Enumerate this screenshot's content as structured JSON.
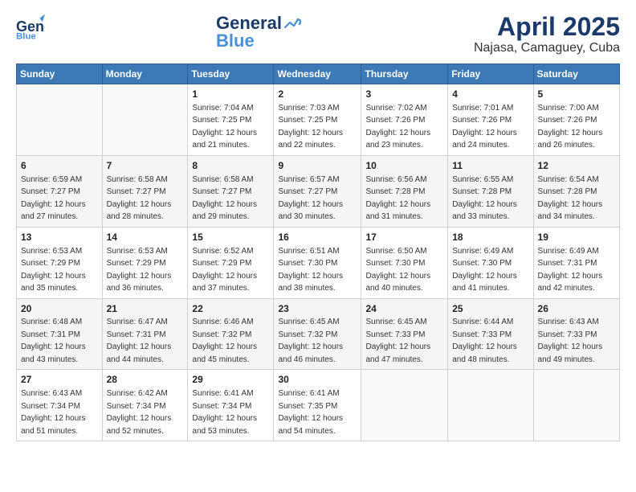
{
  "header": {
    "logo_general": "General",
    "logo_blue": "Blue",
    "month": "April 2025",
    "location": "Najasa, Camaguey, Cuba"
  },
  "days_of_week": [
    "Sunday",
    "Monday",
    "Tuesday",
    "Wednesday",
    "Thursday",
    "Friday",
    "Saturday"
  ],
  "weeks": [
    [
      {
        "day": "",
        "sunrise": "",
        "sunset": "",
        "daylight": ""
      },
      {
        "day": "",
        "sunrise": "",
        "sunset": "",
        "daylight": ""
      },
      {
        "day": "1",
        "sunrise": "Sunrise: 7:04 AM",
        "sunset": "Sunset: 7:25 PM",
        "daylight": "Daylight: 12 hours and 21 minutes."
      },
      {
        "day": "2",
        "sunrise": "Sunrise: 7:03 AM",
        "sunset": "Sunset: 7:25 PM",
        "daylight": "Daylight: 12 hours and 22 minutes."
      },
      {
        "day": "3",
        "sunrise": "Sunrise: 7:02 AM",
        "sunset": "Sunset: 7:26 PM",
        "daylight": "Daylight: 12 hours and 23 minutes."
      },
      {
        "day": "4",
        "sunrise": "Sunrise: 7:01 AM",
        "sunset": "Sunset: 7:26 PM",
        "daylight": "Daylight: 12 hours and 24 minutes."
      },
      {
        "day": "5",
        "sunrise": "Sunrise: 7:00 AM",
        "sunset": "Sunset: 7:26 PM",
        "daylight": "Daylight: 12 hours and 26 minutes."
      }
    ],
    [
      {
        "day": "6",
        "sunrise": "Sunrise: 6:59 AM",
        "sunset": "Sunset: 7:27 PM",
        "daylight": "Daylight: 12 hours and 27 minutes."
      },
      {
        "day": "7",
        "sunrise": "Sunrise: 6:58 AM",
        "sunset": "Sunset: 7:27 PM",
        "daylight": "Daylight: 12 hours and 28 minutes."
      },
      {
        "day": "8",
        "sunrise": "Sunrise: 6:58 AM",
        "sunset": "Sunset: 7:27 PM",
        "daylight": "Daylight: 12 hours and 29 minutes."
      },
      {
        "day": "9",
        "sunrise": "Sunrise: 6:57 AM",
        "sunset": "Sunset: 7:27 PM",
        "daylight": "Daylight: 12 hours and 30 minutes."
      },
      {
        "day": "10",
        "sunrise": "Sunrise: 6:56 AM",
        "sunset": "Sunset: 7:28 PM",
        "daylight": "Daylight: 12 hours and 31 minutes."
      },
      {
        "day": "11",
        "sunrise": "Sunrise: 6:55 AM",
        "sunset": "Sunset: 7:28 PM",
        "daylight": "Daylight: 12 hours and 33 minutes."
      },
      {
        "day": "12",
        "sunrise": "Sunrise: 6:54 AM",
        "sunset": "Sunset: 7:28 PM",
        "daylight": "Daylight: 12 hours and 34 minutes."
      }
    ],
    [
      {
        "day": "13",
        "sunrise": "Sunrise: 6:53 AM",
        "sunset": "Sunset: 7:29 PM",
        "daylight": "Daylight: 12 hours and 35 minutes."
      },
      {
        "day": "14",
        "sunrise": "Sunrise: 6:53 AM",
        "sunset": "Sunset: 7:29 PM",
        "daylight": "Daylight: 12 hours and 36 minutes."
      },
      {
        "day": "15",
        "sunrise": "Sunrise: 6:52 AM",
        "sunset": "Sunset: 7:29 PM",
        "daylight": "Daylight: 12 hours and 37 minutes."
      },
      {
        "day": "16",
        "sunrise": "Sunrise: 6:51 AM",
        "sunset": "Sunset: 7:30 PM",
        "daylight": "Daylight: 12 hours and 38 minutes."
      },
      {
        "day": "17",
        "sunrise": "Sunrise: 6:50 AM",
        "sunset": "Sunset: 7:30 PM",
        "daylight": "Daylight: 12 hours and 40 minutes."
      },
      {
        "day": "18",
        "sunrise": "Sunrise: 6:49 AM",
        "sunset": "Sunset: 7:30 PM",
        "daylight": "Daylight: 12 hours and 41 minutes."
      },
      {
        "day": "19",
        "sunrise": "Sunrise: 6:49 AM",
        "sunset": "Sunset: 7:31 PM",
        "daylight": "Daylight: 12 hours and 42 minutes."
      }
    ],
    [
      {
        "day": "20",
        "sunrise": "Sunrise: 6:48 AM",
        "sunset": "Sunset: 7:31 PM",
        "daylight": "Daylight: 12 hours and 43 minutes."
      },
      {
        "day": "21",
        "sunrise": "Sunrise: 6:47 AM",
        "sunset": "Sunset: 7:31 PM",
        "daylight": "Daylight: 12 hours and 44 minutes."
      },
      {
        "day": "22",
        "sunrise": "Sunrise: 6:46 AM",
        "sunset": "Sunset: 7:32 PM",
        "daylight": "Daylight: 12 hours and 45 minutes."
      },
      {
        "day": "23",
        "sunrise": "Sunrise: 6:45 AM",
        "sunset": "Sunset: 7:32 PM",
        "daylight": "Daylight: 12 hours and 46 minutes."
      },
      {
        "day": "24",
        "sunrise": "Sunrise: 6:45 AM",
        "sunset": "Sunset: 7:33 PM",
        "daylight": "Daylight: 12 hours and 47 minutes."
      },
      {
        "day": "25",
        "sunrise": "Sunrise: 6:44 AM",
        "sunset": "Sunset: 7:33 PM",
        "daylight": "Daylight: 12 hours and 48 minutes."
      },
      {
        "day": "26",
        "sunrise": "Sunrise: 6:43 AM",
        "sunset": "Sunset: 7:33 PM",
        "daylight": "Daylight: 12 hours and 49 minutes."
      }
    ],
    [
      {
        "day": "27",
        "sunrise": "Sunrise: 6:43 AM",
        "sunset": "Sunset: 7:34 PM",
        "daylight": "Daylight: 12 hours and 51 minutes."
      },
      {
        "day": "28",
        "sunrise": "Sunrise: 6:42 AM",
        "sunset": "Sunset: 7:34 PM",
        "daylight": "Daylight: 12 hours and 52 minutes."
      },
      {
        "day": "29",
        "sunrise": "Sunrise: 6:41 AM",
        "sunset": "Sunset: 7:34 PM",
        "daylight": "Daylight: 12 hours and 53 minutes."
      },
      {
        "day": "30",
        "sunrise": "Sunrise: 6:41 AM",
        "sunset": "Sunset: 7:35 PM",
        "daylight": "Daylight: 12 hours and 54 minutes."
      },
      {
        "day": "",
        "sunrise": "",
        "sunset": "",
        "daylight": ""
      },
      {
        "day": "",
        "sunrise": "",
        "sunset": "",
        "daylight": ""
      },
      {
        "day": "",
        "sunrise": "",
        "sunset": "",
        "daylight": ""
      }
    ]
  ]
}
